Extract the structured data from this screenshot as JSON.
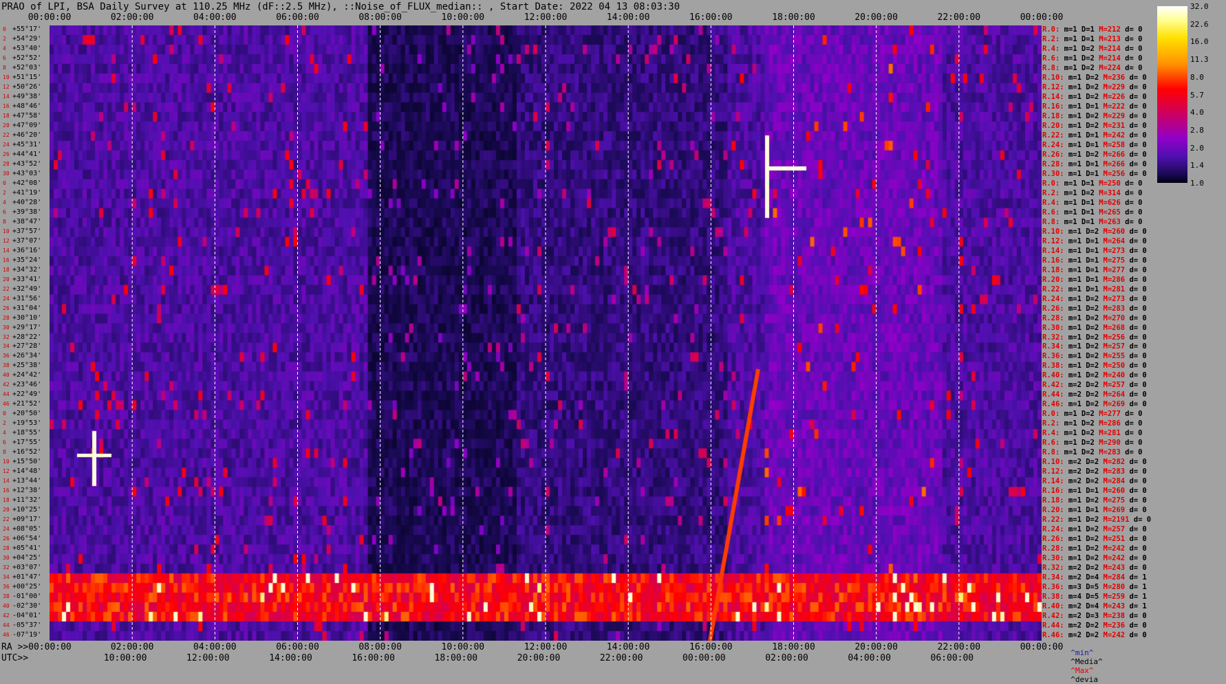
{
  "title": "PRAO of LPI, BSA Daily Survey at 110.25 MHz (dF::2.5 MHz), ::Noise_of_FLUX_median:: , Start Date: 2022 04 13 08:03:30",
  "top_ticks": [
    "00:00:00",
    "02:00:00",
    "04:00:00",
    "06:00:00",
    "08:00:00",
    "10:00:00",
    "12:00:00",
    "14:00:00",
    "16:00:00",
    "18:00:00",
    "20:00:00",
    "22:00:00",
    "00:00:00"
  ],
  "ra_label": "RA >>00:00:00",
  "ra_ticks": [
    "02:00:00",
    "04:00:00",
    "06:00:00",
    "08:00:00",
    "10:00:00",
    "12:00:00",
    "14:00:00",
    "16:00:00",
    "18:00:00",
    "20:00:00",
    "22:00:00",
    "00:00:00"
  ],
  "utc_label": "UTC>>",
  "utc_ticks": [
    "10:00:00",
    "12:00:00",
    "14:00:00",
    "16:00:00",
    "18:00:00",
    "20:00:00",
    "22:00:00",
    "00:00:00",
    "02:00:00",
    "04:00:00",
    "06:00:00"
  ],
  "colorbar": {
    "ticks": [
      "32.0",
      "22.6",
      "16.0",
      "11.3",
      "8.0",
      "5.7",
      "4.0",
      "2.8",
      "2.0",
      "1.4",
      "1.0"
    ]
  },
  "legend": {
    "min": "^min^",
    "median": "^Media^",
    "max": "^Max^",
    "devia": "^devia"
  },
  "chart_data": {
    "type": "heatmap",
    "title": "PRAO of LPI, BSA Daily Survey at 110.25 MHz (dF::2.5 MHz), ::Noise_of_FLUX_median:: , Start Date: 2022 04 13 08:03:30",
    "x_ticks_sidereal": [
      "00:00:00",
      "02:00:00",
      "04:00:00",
      "06:00:00",
      "08:00:00",
      "10:00:00",
      "12:00:00",
      "14:00:00",
      "16:00:00",
      "18:00:00",
      "20:00:00",
      "22:00:00",
      "00:00:00"
    ],
    "x_ticks_utc": [
      "10:00:00",
      "12:00:00",
      "14:00:00",
      "16:00:00",
      "18:00:00",
      "20:00:00",
      "22:00:00",
      "00:00:00",
      "02:00:00",
      "04:00:00",
      "06:00:00"
    ],
    "color_scale": [
      32.0,
      22.6,
      16.0,
      11.3,
      8.0,
      5.7,
      4.0,
      2.8,
      2.0,
      1.4,
      1.0
    ],
    "declinations": [
      "+55°17'",
      "+54°29'",
      "+53°40'",
      "+52°52'",
      "+52°03'",
      "+51°15'",
      "+50°26'",
      "+49°38'",
      "+48°46'",
      "+47°58'",
      "+47°09'",
      "+46°20'",
      "+45°31'",
      "+44°41'",
      "+43°52'",
      "+43°03'",
      "+42°08'",
      "+41°19'",
      "+40°28'",
      "+39°38'",
      "+38°47'",
      "+37°57'",
      "+37°07'",
      "+36°16'",
      "+35°24'",
      "+34°32'",
      "+33°41'",
      "+32°49'",
      "+31°56'",
      "+31°04'",
      "+30°10'",
      "+29°17'",
      "+28°22'",
      "+27°28'",
      "+26°34'",
      "+25°38'",
      "+24°42'",
      "+23°46'",
      "+22°49'",
      "+21°52'",
      "+20°50'",
      "+19°53'",
      "+18°55'",
      "+17°55'",
      "+16°52'",
      "+15°50'",
      "+14°48'",
      "+13°44'",
      "+12°38'",
      "+11°32'",
      "+10°25'",
      "+09°17'",
      "+08°05'",
      "+06°54'",
      "+05°41'",
      "+04°25'",
      "+03°07'",
      "+01°47'",
      "+00°25'",
      "-01°00'",
      "-02°30'",
      "-04°01'",
      "-05°37'",
      "-07°19'"
    ],
    "row_indices": [
      "0",
      "2",
      "4",
      "6",
      "8",
      "10",
      "12",
      "14",
      "16",
      "18",
      "20",
      "22",
      "24",
      "26",
      "28",
      "30",
      "0",
      "2",
      "4",
      "6",
      "8",
      "10",
      "12",
      "14",
      "16",
      "18",
      "20",
      "22",
      "24",
      "26",
      "28",
      "30",
      "32",
      "34",
      "36",
      "38",
      "40",
      "42",
      "44",
      "46",
      "0",
      "2",
      "4",
      "6",
      "8",
      "10",
      "12",
      "14",
      "16",
      "18",
      "20",
      "22",
      "24",
      "26",
      "28",
      "30",
      "32",
      "34",
      "36",
      "38",
      "40",
      "42",
      "44",
      "46"
    ],
    "sensor_stats": [
      {
        "r": "R.0:",
        "m": "m=1",
        "D": "D=1",
        "M": "M=212",
        "d": "d= 0"
      },
      {
        "r": "R.2:",
        "m": "m=1",
        "D": "D=1",
        "M": "M=213",
        "d": "d= 0"
      },
      {
        "r": "R.4:",
        "m": "m=1",
        "D": "D=2",
        "M": "M=214",
        "d": "d= 0"
      },
      {
        "r": "R.6:",
        "m": "m=1",
        "D": "D=2",
        "M": "M=214",
        "d": "d= 0"
      },
      {
        "r": "R.8:",
        "m": "m=1",
        "D": "D=2",
        "M": "M=224",
        "d": "d= 0"
      },
      {
        "r": "R.10:",
        "m": "m=1",
        "D": "D=2",
        "M": "M=236",
        "d": "d= 0"
      },
      {
        "r": "R.12:",
        "m": "m=1",
        "D": "D=2",
        "M": "M=229",
        "d": "d= 0"
      },
      {
        "r": "R.14:",
        "m": "m=1",
        "D": "D=2",
        "M": "M=226",
        "d": "d= 0"
      },
      {
        "r": "R.16:",
        "m": "m=1",
        "D": "D=1",
        "M": "M=222",
        "d": "d= 0"
      },
      {
        "r": "R.18:",
        "m": "m=1",
        "D": "D=2",
        "M": "M=229",
        "d": "d= 0"
      },
      {
        "r": "R.20:",
        "m": "m=1",
        "D": "D=2",
        "M": "M=231",
        "d": "d= 0"
      },
      {
        "r": "R.22:",
        "m": "m=1",
        "D": "D=1",
        "M": "M=242",
        "d": "d= 0"
      },
      {
        "r": "R.24:",
        "m": "m=1",
        "D": "D=1",
        "M": "M=258",
        "d": "d= 0"
      },
      {
        "r": "R.26:",
        "m": "m=1",
        "D": "D=2",
        "M": "M=266",
        "d": "d= 0"
      },
      {
        "r": "R.28:",
        "m": "m=1",
        "D": "D=1",
        "M": "M=266",
        "d": "d= 0"
      },
      {
        "r": "R.30:",
        "m": "m=1",
        "D": "D=1",
        "M": "M=256",
        "d": "d= 0"
      },
      {
        "r": "R.0:",
        "m": "m=1",
        "D": "D=1",
        "M": "M=250",
        "d": "d= 0"
      },
      {
        "r": "R.2:",
        "m": "m=1",
        "D": "D=2",
        "M": "M=314",
        "d": "d= 0"
      },
      {
        "r": "R.4:",
        "m": "m=1",
        "D": "D=1",
        "M": "M=626",
        "d": "d= 0"
      },
      {
        "r": "R.6:",
        "m": "m=1",
        "D": "D=1",
        "M": "M=265",
        "d": "d= 0"
      },
      {
        "r": "R.8:",
        "m": "m=1",
        "D": "D=1",
        "M": "M=263",
        "d": "d= 0"
      },
      {
        "r": "R.10:",
        "m": "m=1",
        "D": "D=2",
        "M": "M=260",
        "d": "d= 0"
      },
      {
        "r": "R.12:",
        "m": "m=1",
        "D": "D=1",
        "M": "M=264",
        "d": "d= 0"
      },
      {
        "r": "R.14:",
        "m": "m=1",
        "D": "D=1",
        "M": "M=273",
        "d": "d= 0"
      },
      {
        "r": "R.16:",
        "m": "m=1",
        "D": "D=1",
        "M": "M=275",
        "d": "d= 0"
      },
      {
        "r": "R.18:",
        "m": "m=1",
        "D": "D=1",
        "M": "M=277",
        "d": "d= 0"
      },
      {
        "r": "R.20:",
        "m": "m=1",
        "D": "D=1",
        "M": "M=286",
        "d": "d= 0"
      },
      {
        "r": "R.22:",
        "m": "m=1",
        "D": "D=1",
        "M": "M=281",
        "d": "d= 0"
      },
      {
        "r": "R.24:",
        "m": "m=1",
        "D": "D=2",
        "M": "M=273",
        "d": "d= 0"
      },
      {
        "r": "R.26:",
        "m": "m=1",
        "D": "D=2",
        "M": "M=283",
        "d": "d= 0"
      },
      {
        "r": "R.28:",
        "m": "m=1",
        "D": "D=2",
        "M": "M=270",
        "d": "d= 0"
      },
      {
        "r": "R.30:",
        "m": "m=1",
        "D": "D=2",
        "M": "M=268",
        "d": "d= 0"
      },
      {
        "r": "R.32:",
        "m": "m=1",
        "D": "D=2",
        "M": "M=256",
        "d": "d= 0"
      },
      {
        "r": "R.34:",
        "m": "m=1",
        "D": "D=2",
        "M": "M=257",
        "d": "d= 0"
      },
      {
        "r": "R.36:",
        "m": "m=1",
        "D": "D=2",
        "M": "M=255",
        "d": "d= 0"
      },
      {
        "r": "R.38:",
        "m": "m=1",
        "D": "D=2",
        "M": "M=250",
        "d": "d= 0"
      },
      {
        "r": "R.40:",
        "m": "m=1",
        "D": "D=2",
        "M": "M=240",
        "d": "d= 0"
      },
      {
        "r": "R.42:",
        "m": "m=2",
        "D": "D=2",
        "M": "M=257",
        "d": "d= 0"
      },
      {
        "r": "R.44:",
        "m": "m=2",
        "D": "D=2",
        "M": "M=264",
        "d": "d= 0"
      },
      {
        "r": "R.46:",
        "m": "m=1",
        "D": "D=2",
        "M": "M=269",
        "d": "d= 0"
      },
      {
        "r": "R.0:",
        "m": "m=1",
        "D": "D=2",
        "M": "M=277",
        "d": "d= 0"
      },
      {
        "r": "R.2:",
        "m": "m=1",
        "D": "D=2",
        "M": "M=286",
        "d": "d= 0"
      },
      {
        "r": "R.4:",
        "m": "m=1",
        "D": "D=2",
        "M": "M=281",
        "d": "d= 0"
      },
      {
        "r": "R.6:",
        "m": "m=1",
        "D": "D=2",
        "M": "M=290",
        "d": "d= 0"
      },
      {
        "r": "R.8:",
        "m": "m=1",
        "D": "D=2",
        "M": "M=283",
        "d": "d= 0"
      },
      {
        "r": "R.10:",
        "m": "m=2",
        "D": "D=2",
        "M": "M=282",
        "d": "d= 0"
      },
      {
        "r": "R.12:",
        "m": "m=2",
        "D": "D=2",
        "M": "M=283",
        "d": "d= 0"
      },
      {
        "r": "R.14:",
        "m": "m=2",
        "D": "D=2",
        "M": "M=284",
        "d": "d= 0"
      },
      {
        "r": "R.16:",
        "m": "m=1",
        "D": "D=1",
        "M": "M=260",
        "d": "d= 0"
      },
      {
        "r": "R.18:",
        "m": "m=1",
        "D": "D=2",
        "M": "M=275",
        "d": "d= 0"
      },
      {
        "r": "R.20:",
        "m": "m=1",
        "D": "D=1",
        "M": "M=269",
        "d": "d= 0"
      },
      {
        "r": "R.22:",
        "m": "m=1",
        "D": "D=2",
        "M": "M=2191",
        "d": "d= 0"
      },
      {
        "r": "R.24:",
        "m": "m=1",
        "D": "D=2",
        "M": "M=257",
        "d": "d= 0"
      },
      {
        "r": "R.26:",
        "m": "m=1",
        "D": "D=2",
        "M": "M=251",
        "d": "d= 0"
      },
      {
        "r": "R.28:",
        "m": "m=1",
        "D": "D=2",
        "M": "M=242",
        "d": "d= 0"
      },
      {
        "r": "R.30:",
        "m": "m=1",
        "D": "D=2",
        "M": "M=242",
        "d": "d= 0"
      },
      {
        "r": "R.32:",
        "m": "m=2",
        "D": "D=2",
        "M": "M=243",
        "d": "d= 0"
      },
      {
        "r": "R.34:",
        "m": "m=2",
        "D": "D=4",
        "M": "M=284",
        "d": "d= 1"
      },
      {
        "r": "R.36:",
        "m": "m=3",
        "D": "D=5",
        "M": "M=280",
        "d": "d= 1"
      },
      {
        "r": "R.38:",
        "m": "m=4",
        "D": "D=5",
        "M": "M=259",
        "d": "d= 1"
      },
      {
        "r": "R.40:",
        "m": "m=2",
        "D": "D=4",
        "M": "M=243",
        "d": "d= 1"
      },
      {
        "r": "R.42:",
        "m": "m=2",
        "D": "D=3",
        "M": "M=238",
        "d": "d= 0"
      },
      {
        "r": "R.44:",
        "m": "m=2",
        "D": "D=2",
        "M": "M=236",
        "d": "d= 0"
      },
      {
        "r": "R.46:",
        "m": "m=2",
        "D": "D=2",
        "M": "M=242",
        "d": "d= 0"
      }
    ]
  }
}
